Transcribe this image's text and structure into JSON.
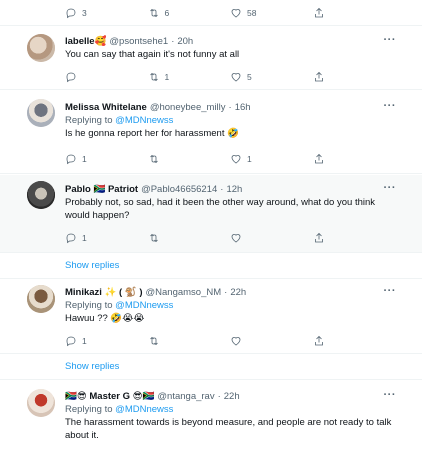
{
  "top_actions": {
    "replies": "3",
    "retweets": "6",
    "likes": "58"
  },
  "tweets": [
    {
      "name": "labelle🥰",
      "handle": "@psontsehe1",
      "time": "20h",
      "replying_to": "",
      "mention": "",
      "text": "You can say that again it's not funny at all",
      "replies": "",
      "retweets": "1",
      "likes": "5"
    },
    {
      "name": "Melissa Whitelane",
      "handle": "@honeybee_milly",
      "time": "16h",
      "replying_to": "Replying to",
      "mention": "@MDNnewss",
      "text": "Is he gonna report her for harassment 🤣",
      "replies": "1",
      "retweets": "",
      "likes": "1"
    },
    {
      "name": "Pablo 🇿🇦 Patriot",
      "handle": "@Pablo46656214",
      "time": "12h",
      "replying_to": "",
      "mention": "",
      "text": "Probably not, so sad, had it been the other way around, what do you think would happen?",
      "replies": "1",
      "retweets": "",
      "likes": ""
    },
    {
      "name": "Minikazi ✨ ( 🐒 )",
      "handle": "@Nangamso_NM",
      "time": "22h",
      "replying_to": "Replying to",
      "mention": "@MDNnewss",
      "text": "Hawuu ?? 🤣😭😭",
      "replies": "1",
      "retweets": "",
      "likes": ""
    },
    {
      "name": "🇿🇦😎 Master G 😎🇿🇦",
      "handle": "@ntanga_rav",
      "time": "22h",
      "replying_to": "Replying to",
      "mention": "@MDNnewss",
      "text": "The harassment towards is beyond measure, and people are not ready to talk about it.",
      "replies": "",
      "retweets": "",
      "likes": ""
    }
  ],
  "show_replies_label": "Show replies",
  "more_label": "···",
  "dot": "·",
  "colors": {
    "accent": "#1d9bf0",
    "muted": "#536471",
    "text": "#0f1419",
    "highlight_bg": "#f7f9f9"
  }
}
